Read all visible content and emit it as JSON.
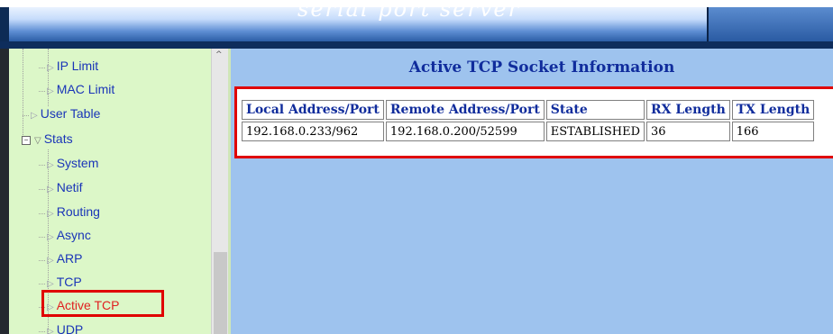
{
  "header": {
    "title": "serial port server"
  },
  "sidebar": {
    "items": [
      {
        "label": "IP Limit"
      },
      {
        "label": "MAC Limit"
      },
      {
        "label": "User Table"
      },
      {
        "label": "Stats"
      },
      {
        "label": "System"
      },
      {
        "label": "Netif"
      },
      {
        "label": "Routing"
      },
      {
        "label": "Async"
      },
      {
        "label": "ARP"
      },
      {
        "label": "TCP"
      },
      {
        "label": "Active TCP"
      },
      {
        "label": "UDP"
      }
    ],
    "active": "Active TCP"
  },
  "main": {
    "title": "Active TCP Socket Information",
    "table": {
      "headers": [
        "Local Address/Port",
        "Remote Address/Port",
        "State",
        "RX Length",
        "TX Length"
      ],
      "rows": [
        [
          "192.168.0.233/962",
          "192.168.0.200/52599",
          "ESTABLISHED",
          "36",
          "166"
        ]
      ]
    }
  },
  "colors": {
    "highlight": "#e00000",
    "link": "#1a35b8",
    "active": "#e02020",
    "title": "#102c9c"
  }
}
